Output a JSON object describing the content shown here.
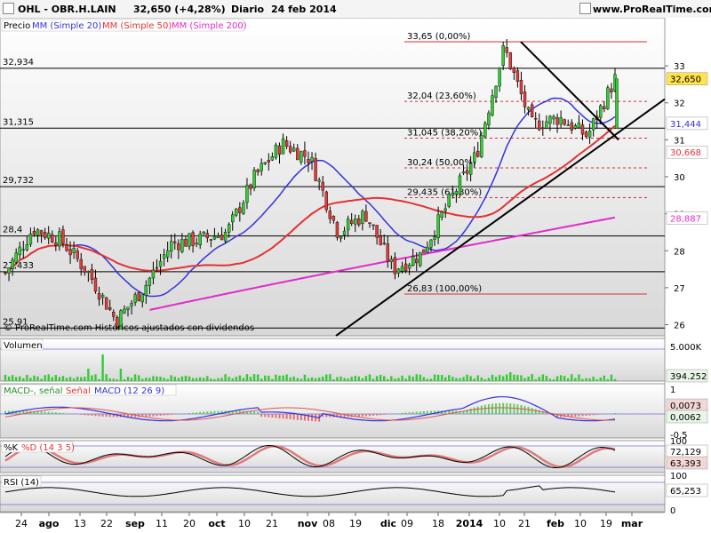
{
  "header": {
    "instrument": "OHL - OBR.H.LAIN",
    "quote": "32,650 (+4,28%)",
    "timeframe": "Diario",
    "date": "24 feb 2014",
    "site": "www.ProRealTime.com"
  },
  "legend": {
    "precio": "Precio",
    "mm20": "MM (Simple 20)",
    "mm50": "MM (Simple 50)",
    "mm200": "MM (Simple 200)"
  },
  "footer_note": "© ProRealTime.com  Históricos ajustados con dividendos",
  "colors": {
    "up": "#33cc33",
    "down": "#e23b3b",
    "mm20": "#3333dd",
    "mm50": "#e33232",
    "mm200": "#e22ac9",
    "fib": "#cc3333",
    "volume": "#33cc33",
    "macd_pos": "#66cc66",
    "macd_neg": "#e07070"
  },
  "price_panel": {
    "y_ticks": [
      "33",
      "32",
      "31",
      "30",
      "29",
      "28",
      "27",
      "26"
    ],
    "levels": [
      {
        "value": 32.934,
        "label": "32,934"
      },
      {
        "value": 31.315,
        "label": "31,315"
      },
      {
        "value": 29.732,
        "label": "29,732"
      },
      {
        "value": 28.4,
        "label": "28,4"
      },
      {
        "value": 27.433,
        "label": "27,433"
      },
      {
        "value": 25.91,
        "label": "25,91"
      }
    ],
    "right_badges": {
      "last": "32,650",
      "mm20": "31,444",
      "mm50": "30,668",
      "mm200": "28,887"
    },
    "fibonacci": [
      {
        "value": 33.65,
        "label": "33,65 (0,00%)"
      },
      {
        "value": 32.04,
        "label": "32,04 (23,60%)"
      },
      {
        "value": 31.045,
        "label": "31,045 (38,20%)"
      },
      {
        "value": 30.24,
        "label": "30,24 (50,00%)"
      },
      {
        "value": 29.435,
        "label": "29,435 (61,80%)"
      },
      {
        "value": 26.83,
        "label": "26,83 (100,00%)"
      }
    ]
  },
  "volume_panel": {
    "title": "Volumen",
    "tick": "5.000K",
    "badge": "394.252"
  },
  "macd_panel": {
    "title_main": "MACD-, señal",
    "title_signal": "Señal",
    "title_macd": "MACD (12 26 9)",
    "y_ticks": [
      "1",
      "0,5",
      "0",
      "-0,5"
    ],
    "badges": [
      "0,0073",
      "0,0062"
    ]
  },
  "stoch_panel": {
    "title_k": "%K",
    "title_d": "%D (14 3 5)",
    "tick_top": "100",
    "badges": [
      "72,129",
      "63,393"
    ]
  },
  "rsi_panel": {
    "title": "RSI (14)",
    "tick_top": "100",
    "tick_bottom": "0",
    "badge": "65,253"
  },
  "x_axis": {
    "labels": [
      "24",
      "ago",
      "13",
      "22",
      "sep",
      "11",
      "20",
      "oct",
      "10",
      "21",
      "nov",
      "08",
      "19",
      "dic",
      "09",
      "18",
      "2014",
      "10",
      "21",
      "feb",
      "10",
      "19",
      "mar"
    ]
  },
  "chart_data": {
    "type": "candlestick",
    "title": "OHL - OBR.H.LAIN",
    "x": [
      "2013-07-24",
      "2013-08-01",
      "2013-08-13",
      "2013-08-22",
      "2013-09-02",
      "2013-09-11",
      "2013-09-20",
      "2013-10-01",
      "2013-10-10",
      "2013-10-21",
      "2013-11-01",
      "2013-11-08",
      "2013-11-19",
      "2013-12-02",
      "2013-12-09",
      "2013-12-18",
      "2014-01-02",
      "2014-01-10",
      "2014-01-21",
      "2014-02-03",
      "2014-02-10",
      "2014-02-19",
      "2014-03-03"
    ],
    "series": [
      {
        "name": "Precio",
        "close_path": [
          27.4,
          28.6,
          28.3,
          27.4,
          26.1,
          27.0,
          28.2,
          28.3,
          28.5,
          30.0,
          30.9,
          30.5,
          28.5,
          29.0,
          27.5,
          27.9,
          29.3,
          30.6,
          33.5,
          31.4,
          31.6,
          31.1,
          32.65
        ]
      },
      {
        "name": "MM (Simple 20)",
        "last": 31.444
      },
      {
        "name": "MM (Simple 50)",
        "last": 30.668
      },
      {
        "name": "MM (Simple 200)",
        "last": 28.887
      }
    ],
    "ylim": [
      25.7,
      34.3
    ],
    "last": 32.65,
    "change_pct": 4.28
  }
}
